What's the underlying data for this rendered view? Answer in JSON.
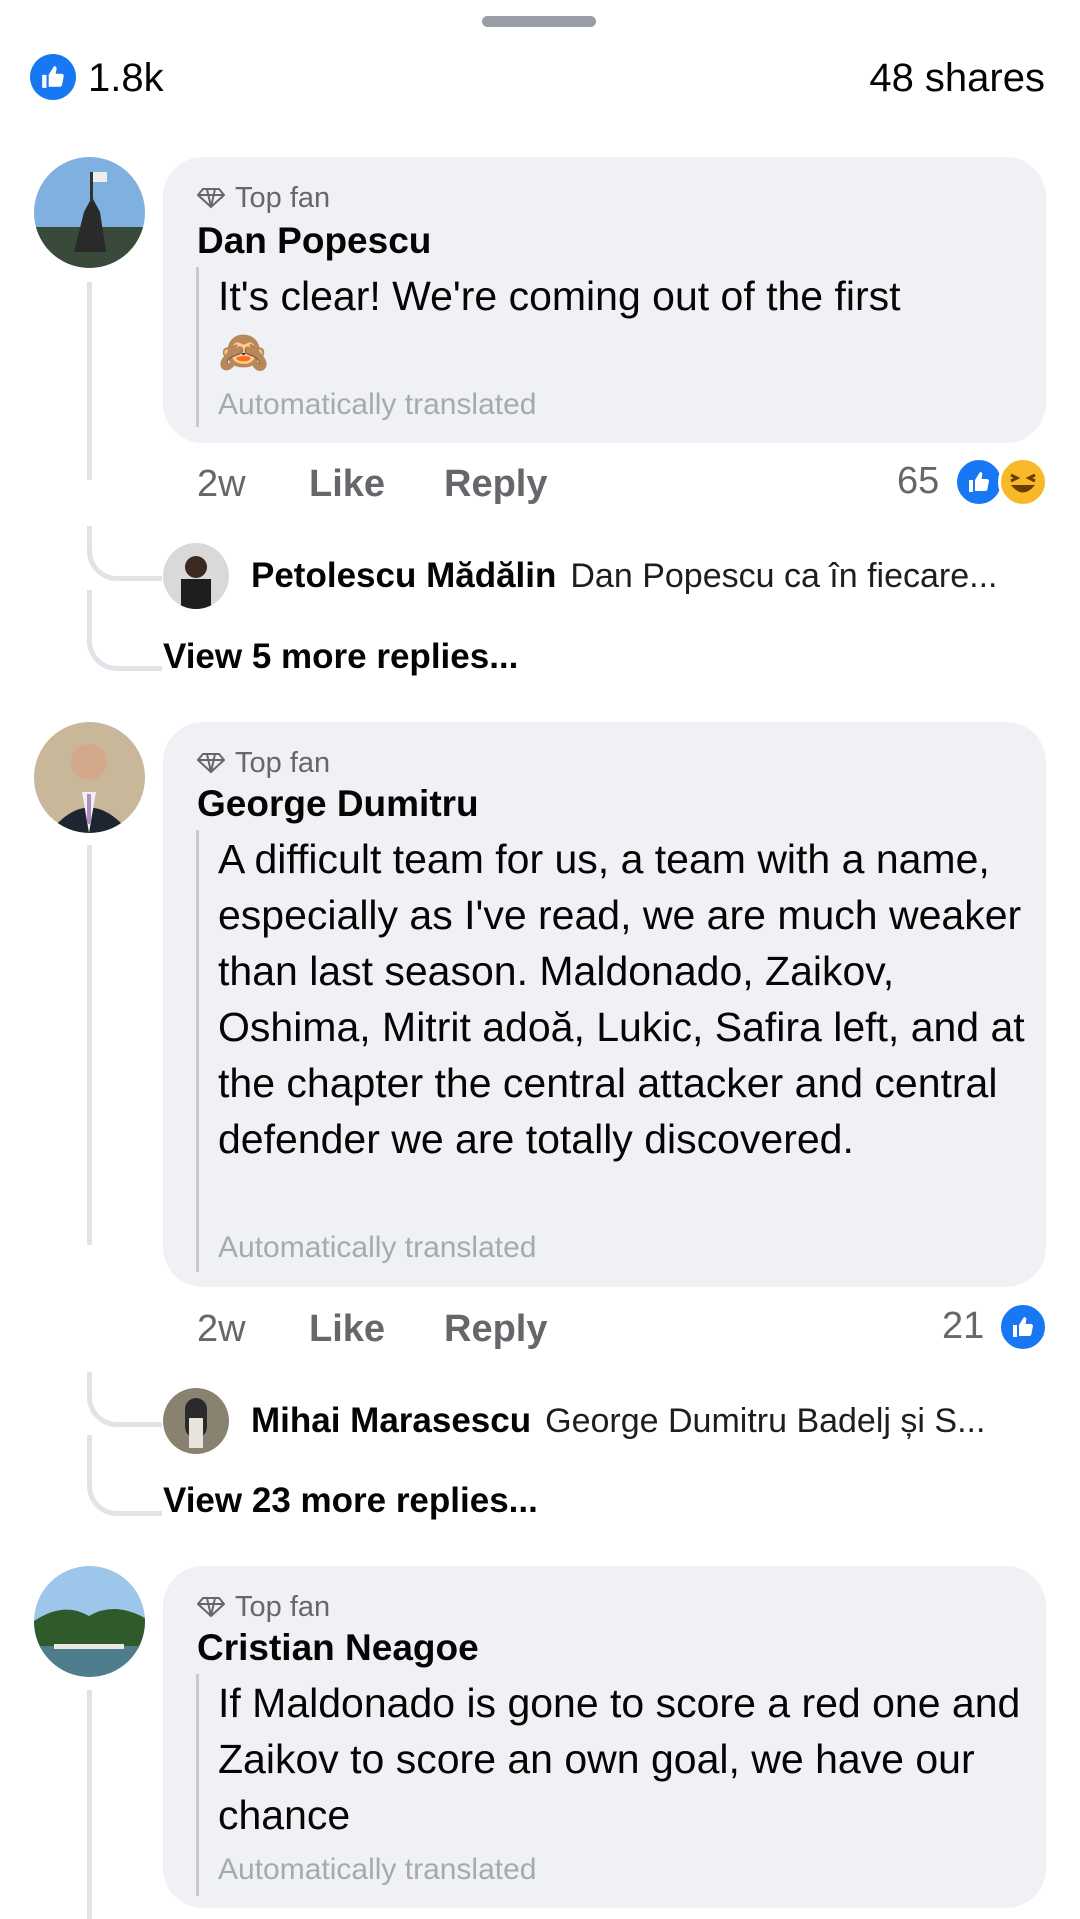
{
  "header": {
    "like_count": "1.8k",
    "shares": "48 shares"
  },
  "colors": {
    "like_blue": "#1877f2",
    "bubble_bg": "#f0f1f4",
    "muted_text": "#65676b"
  },
  "comments": [
    {
      "badge": "Top fan",
      "author": "Dan Popescu",
      "text": "It's clear! We're coming out of the first",
      "emoji": "🙈",
      "translated": "Automatically translated",
      "time": "2w",
      "like": "Like",
      "reply": "Reply",
      "reactions": "65",
      "reaction_icons": [
        "like-icon",
        "haha-icon"
      ],
      "reply_preview": {
        "author": "Petolescu Mădălin",
        "text": "Dan Popescu ca în fiecare..."
      },
      "view_more": "View 5 more replies..."
    },
    {
      "badge": "Top fan",
      "author": "George Dumitru",
      "text": "A difficult team for us, a team with a name, especially as I've read, we are much weaker than last season. Maldonado, Zaikov, Oshima, Mitrit adoă, Lukic, Safira left, and at the chapter the central attacker and central defender we are totally discovered.",
      "translated": "Automatically translated",
      "time": "2w",
      "like": "Like",
      "reply": "Reply",
      "reactions": "21",
      "reaction_icons": [
        "like-icon"
      ],
      "reply_preview": {
        "author": "Mihai Marasescu",
        "text": "George Dumitru Badelj și S..."
      },
      "view_more": "View 23 more replies..."
    },
    {
      "badge": "Top fan",
      "author": "Cristian Neagoe",
      "text": "If Maldonado is gone to score a red one and Zaikov to score an own goal, we have our chance",
      "translated": "Automatically translated"
    }
  ]
}
